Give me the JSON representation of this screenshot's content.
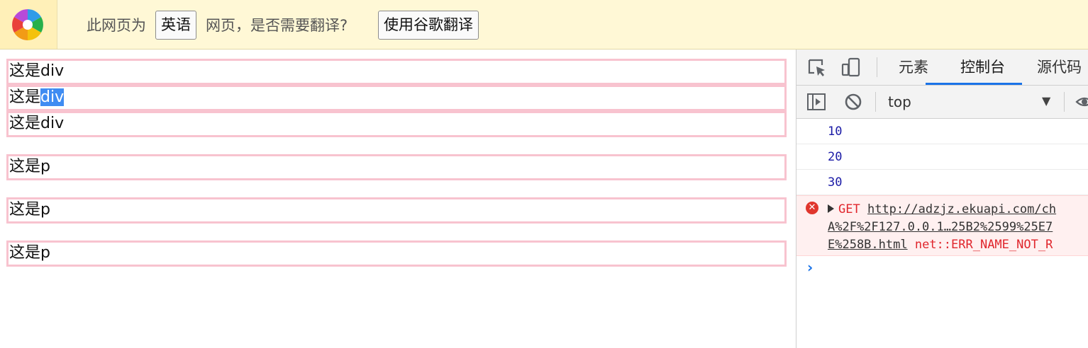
{
  "translate_bar": {
    "prefix": "此网页为",
    "language": "英语",
    "suffix": "网页，是否需要翻译?",
    "translate_button": "使用谷歌翻译"
  },
  "page": {
    "blocks": [
      {
        "prefix": "这是",
        "suffix": "div"
      },
      {
        "prefix": "这是",
        "selected": "div"
      },
      {
        "prefix": "这是",
        "suffix": "div"
      },
      {
        "prefix": "这是",
        "suffix": "p"
      },
      {
        "prefix": "这是",
        "suffix": "p"
      },
      {
        "prefix": "这是",
        "suffix": "p"
      }
    ]
  },
  "devtools": {
    "tabs": [
      "元素",
      "控制台",
      "源代码"
    ],
    "active_tab": "控制台",
    "context": "top",
    "logs": [
      "10",
      "20",
      "30"
    ],
    "error": {
      "method": "GET",
      "url_line1": "http://adzjz.ekuapi.com/ch",
      "url_line2": "A%2F%2F127.0.0.1…25B2%2599%25E7",
      "url_line3": "E%258B.html",
      "message": "net::ERR_NAME_NOT_R"
    }
  },
  "colors": {
    "bar_bg": "#fff8d6",
    "block_border": "#f8c3cf",
    "selection": "#3f8cf2",
    "accent": "#1a73e8",
    "error_red": "#e0262d",
    "log_number": "#1a1aa6"
  },
  "icons": [
    "browser-logo-icon",
    "inspect-icon",
    "device-toolbar-icon",
    "sidebar-toggle-icon",
    "clear-console-icon",
    "dropdown-arrow-icon",
    "eye-icon",
    "error-icon",
    "expand-triangle-icon",
    "prompt-chevron-icon"
  ]
}
